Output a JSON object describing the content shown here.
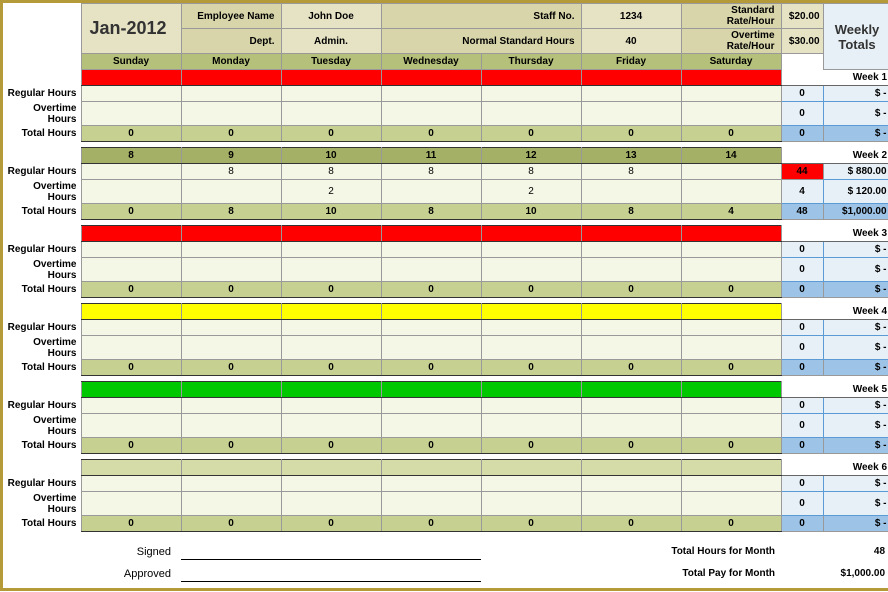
{
  "header": {
    "month": "Jan-2012",
    "meta": {
      "emp_name_lbl": "Employee Name",
      "emp_name_val": "John Doe",
      "dept_lbl": "Dept.",
      "dept_val": "Admin.",
      "staff_lbl": "Staff No.",
      "staff_val": "1234",
      "normhrs_lbl": "Normal Standard Hours",
      "normhrs_val": "40",
      "stdrate_lbl": "Standard Rate/Hour",
      "stdrate_val": "$20.00",
      "otrate_lbl": "Overtime Rate/Hour",
      "otrate_val": "$30.00"
    },
    "days": [
      "Sunday",
      "Monday",
      "Tuesday",
      "Wednesday",
      "Thursday",
      "Friday",
      "Saturday"
    ],
    "weekly_totals": "Weekly Totals"
  },
  "rowlabels": {
    "reg": "Regular Hours",
    "ot": "Overtime Hours",
    "tot": "Total Hours"
  },
  "weeks": [
    {
      "label": "Week 1",
      "bar_style": "bar-red",
      "dates": [
        "",
        "",
        "",
        "",
        "",
        "",
        ""
      ],
      "reg": [
        "",
        "",
        "",
        "",
        "",
        "",
        ""
      ],
      "ot": [
        "",
        "",
        "",
        "",
        "",
        "",
        ""
      ],
      "tot": [
        "0",
        "0",
        "0",
        "0",
        "0",
        "0",
        "0"
      ],
      "wt": {
        "reg_n": "0",
        "reg_m": "$     -",
        "ot_n": "0",
        "ot_m": "$     -",
        "tot_n": "0",
        "tot_m": "$     -"
      },
      "reg_highlight": false
    },
    {
      "label": "Week 2",
      "bar_style": "bar-olive",
      "dates": [
        "8",
        "9",
        "10",
        "11",
        "12",
        "13",
        "14"
      ],
      "reg": [
        "",
        "8",
        "8",
        "8",
        "8",
        "8",
        ""
      ],
      "ot": [
        "",
        "",
        "2",
        "",
        "2",
        "",
        ""
      ],
      "tot": [
        "0",
        "8",
        "10",
        "8",
        "10",
        "8",
        "4"
      ],
      "wt": {
        "reg_n": "44",
        "reg_m": "$   880.00",
        "ot_n": "4",
        "ot_m": "$   120.00",
        "tot_n": "48",
        "tot_m": "$1,000.00"
      },
      "reg_highlight": true
    },
    {
      "label": "Week 3",
      "bar_style": "bar-red",
      "dates": [
        "",
        "",
        "",
        "",
        "",
        "",
        ""
      ],
      "reg": [
        "",
        "",
        "",
        "",
        "",
        "",
        ""
      ],
      "ot": [
        "",
        "",
        "",
        "",
        "",
        "",
        ""
      ],
      "tot": [
        "0",
        "0",
        "0",
        "0",
        "0",
        "0",
        "0"
      ],
      "wt": {
        "reg_n": "0",
        "reg_m": "$     -",
        "ot_n": "0",
        "ot_m": "$     -",
        "tot_n": "0",
        "tot_m": "$     -"
      },
      "reg_highlight": false
    },
    {
      "label": "Week 4",
      "bar_style": "bar-yellow",
      "dates": [
        "",
        "",
        "",
        "",
        "",
        "",
        ""
      ],
      "reg": [
        "",
        "",
        "",
        "",
        "",
        "",
        ""
      ],
      "ot": [
        "",
        "",
        "",
        "",
        "",
        "",
        ""
      ],
      "tot": [
        "0",
        "0",
        "0",
        "0",
        "0",
        "0",
        "0"
      ],
      "wt": {
        "reg_n": "0",
        "reg_m": "$     -",
        "ot_n": "0",
        "ot_m": "$     -",
        "tot_n": "0",
        "tot_m": "$     -"
      },
      "reg_highlight": false
    },
    {
      "label": "Week 5",
      "bar_style": "bar-green",
      "dates": [
        "",
        "",
        "",
        "",
        "",
        "",
        ""
      ],
      "reg": [
        "",
        "",
        "",
        "",
        "",
        "",
        ""
      ],
      "ot": [
        "",
        "",
        "",
        "",
        "",
        "",
        ""
      ],
      "tot": [
        "0",
        "0",
        "0",
        "0",
        "0",
        "0",
        "0"
      ],
      "wt": {
        "reg_n": "0",
        "reg_m": "$     -",
        "ot_n": "0",
        "ot_m": "$     -",
        "tot_n": "0",
        "tot_m": "$     -"
      },
      "reg_highlight": false
    },
    {
      "label": "Week 6",
      "bar_style": "bar-pale",
      "dates": [
        "",
        "",
        "",
        "",
        "",
        "",
        ""
      ],
      "reg": [
        "",
        "",
        "",
        "",
        "",
        "",
        ""
      ],
      "ot": [
        "",
        "",
        "",
        "",
        "",
        "",
        ""
      ],
      "tot": [
        "0",
        "0",
        "0",
        "0",
        "0",
        "0",
        "0"
      ],
      "wt": {
        "reg_n": "0",
        "reg_m": "$     -",
        "ot_n": "0",
        "ot_m": "$     -",
        "tot_n": "0",
        "tot_m": "$     -"
      },
      "reg_highlight": false
    }
  ],
  "footer": {
    "signed": "Signed",
    "approved": "Approved",
    "tot_hrs_lbl": "Total Hours for Month",
    "tot_hrs_val": "48",
    "tot_pay_lbl": "Total Pay for Month",
    "tot_pay_val": "$1,000.00"
  }
}
